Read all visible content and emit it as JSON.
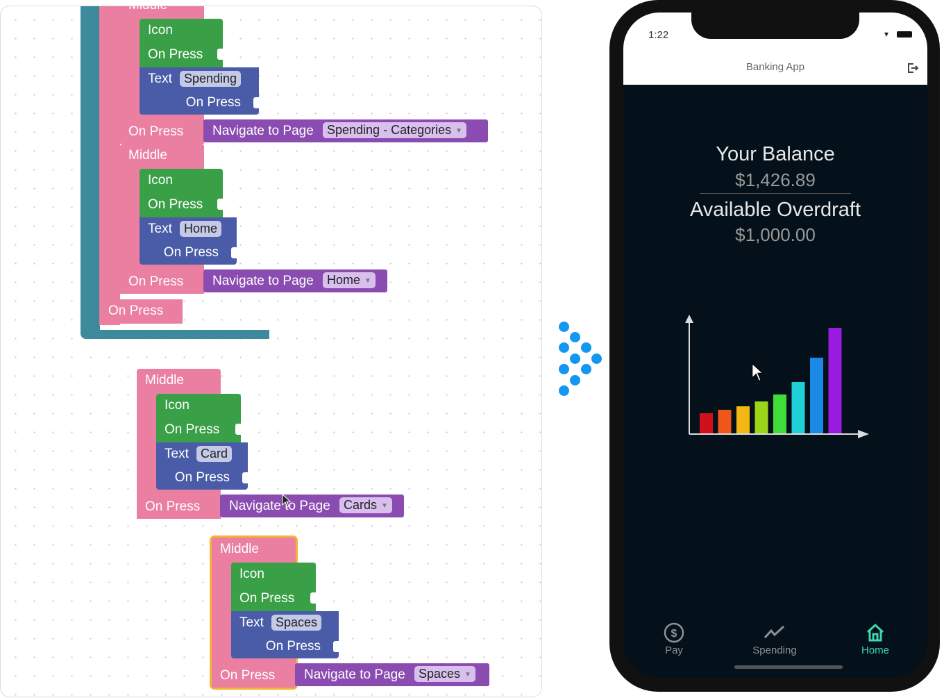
{
  "canvas": {
    "top_group": {
      "items": [
        {
          "header": "Middle",
          "icon": "Icon",
          "icon_press": "On Press",
          "text": "Text",
          "text_value": "Spending",
          "text_press": "On Press",
          "on_press": "On Press",
          "nav": "Navigate to Page",
          "page": "Spending - Categories"
        },
        {
          "header": "Middle",
          "icon": "Icon",
          "icon_press": "On Press",
          "text": "Text",
          "text_value": "Home",
          "text_press": "On Press",
          "on_press": "On Press",
          "nav": "Navigate to Page",
          "page": "Home"
        }
      ],
      "outer_press": "On Press"
    },
    "loose_groups": [
      {
        "header": "Middle",
        "icon": "Icon",
        "icon_press": "On Press",
        "text": "Text",
        "text_value": "Card",
        "text_press": "On Press",
        "on_press": "On Press",
        "nav": "Navigate to Page",
        "page": "Cards",
        "selected": false
      },
      {
        "header": "Middle",
        "icon": "Icon",
        "icon_press": "On Press",
        "text": "Text",
        "text_value": "Spaces",
        "text_press": "On Press",
        "on_press": "On Press",
        "nav": "Navigate to Page",
        "page": "Spaces",
        "selected": true
      }
    ],
    "colors": {
      "middle": "#ea7fa2",
      "icon": "#3aa047",
      "text": "#4a5ca8",
      "navigate": "#8a4cb0",
      "container": "#3d8a9c",
      "selected_outline": "#f5b431"
    }
  },
  "transition_icon": "dots-chevron-right-icon",
  "phone": {
    "status": {
      "time": "1:22"
    },
    "header": {
      "title": "Banking App",
      "logout_icon": "logout-icon"
    },
    "balance": {
      "label": "Your Balance",
      "value": "$1,426.89"
    },
    "overdraft": {
      "label": "Available Overdraft",
      "value": "$1,000.00"
    },
    "chart": {
      "type": "bar",
      "values": [
        3,
        3.5,
        4,
        4.7,
        5.7,
        7.5,
        11,
        15.3
      ],
      "colors": [
        "#d0101a",
        "#f0561a",
        "#f3b714",
        "#9bd51a",
        "#3fdc3a",
        "#1fd1d6",
        "#1b8ae6",
        "#9a1ae0"
      ]
    },
    "tabs": [
      {
        "label": "Pay",
        "icon": "dollar-circle-icon",
        "active": false
      },
      {
        "label": "Spending",
        "icon": "trend-line-icon",
        "active": false
      },
      {
        "label": "Home",
        "icon": "home-icon",
        "active": true
      }
    ],
    "accent": "#3fd6b0"
  }
}
